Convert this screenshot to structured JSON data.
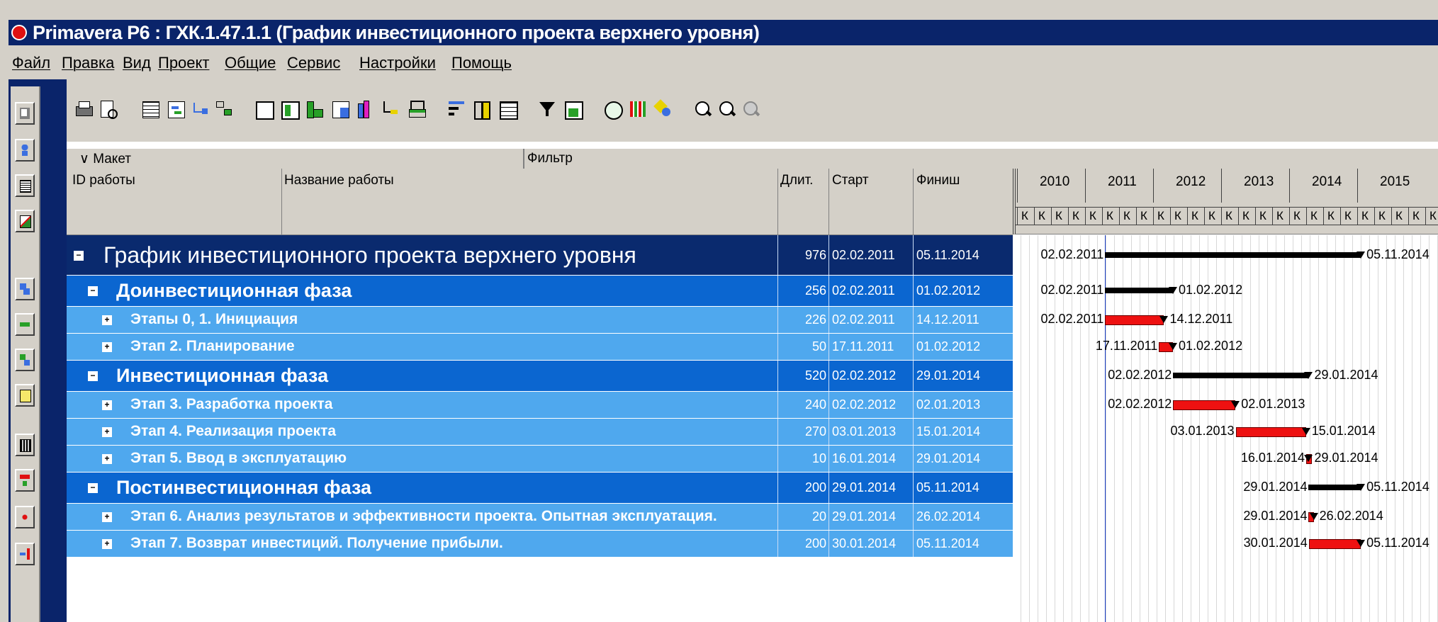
{
  "window": {
    "title": "Primavera P6 : ГХК.1.47.1.1 (График инвестиционного проекта верхнего уровня)"
  },
  "menu": [
    "Файл",
    "Правка",
    "Вид",
    "Проект",
    "Общие",
    "Сервис",
    "Настройки",
    "Помощь"
  ],
  "layout_bar": {
    "layout_label": "Макет",
    "filter_label": "Фильтр"
  },
  "columns": {
    "id": "ID работы",
    "name": "Название работы",
    "duration": "Длит.",
    "start": "Старт",
    "finish": "Финиш"
  },
  "timescale": {
    "years": [
      "2010",
      "2011",
      "2012",
      "2013",
      "2014",
      "2015"
    ],
    "quarter_label": "К"
  },
  "rows": [
    {
      "name": "График инвестиционного проекта верхнего уровня",
      "duration": "976",
      "start": "02.02.2011",
      "finish": "05.11.2014",
      "level": 0,
      "expander": "−"
    },
    {
      "name": "Доинвестиционная фаза",
      "duration": "256",
      "start": "02.02.2011",
      "finish": "01.02.2012",
      "level": 1,
      "expander": "−"
    },
    {
      "name": "Этапы 0, 1. Инициация",
      "duration": "226",
      "start": "02.02.2011",
      "finish": "14.12.2011",
      "level": 2,
      "expander": "+"
    },
    {
      "name": "Этап 2. Планирование",
      "duration": "50",
      "start": "17.11.2011",
      "finish": "01.02.2012",
      "level": 2,
      "expander": "+"
    },
    {
      "name": "Инвестиционная фаза",
      "duration": "520",
      "start": "02.02.2012",
      "finish": "29.01.2014",
      "level": 1,
      "expander": "−"
    },
    {
      "name": "Этап 3. Разработка проекта",
      "duration": "240",
      "start": "02.02.2012",
      "finish": "02.01.2013",
      "level": 2,
      "expander": "+"
    },
    {
      "name": "Этап 4. Реализация проекта",
      "duration": "270",
      "start": "03.01.2013",
      "finish": "15.01.2014",
      "level": 2,
      "expander": "+"
    },
    {
      "name": "Этап 5. Ввод в эксплуатацию",
      "duration": "10",
      "start": "16.01.2014",
      "finish": "29.01.2014",
      "level": 2,
      "expander": "+"
    },
    {
      "name": "Постинвестиционная фаза",
      "duration": "200",
      "start": "29.01.2014",
      "finish": "05.11.2014",
      "level": 1,
      "expander": "−"
    },
    {
      "name": "Этап 6. Анализ результатов  и эффективности проекта. Опытная эксплуатация.",
      "duration": "20",
      "start": "29.01.2014",
      "finish": "26.02.2014",
      "level": 2,
      "expander": "+"
    },
    {
      "name": "Этап 7. Возврат инвестиций. Получение прибыли.",
      "duration": "200",
      "start": "30.01.2014",
      "finish": "05.11.2014",
      "level": 2,
      "expander": "+"
    }
  ],
  "icons": {
    "left_toolbar": [
      "projects-icon",
      "resources-icon",
      "reports-icon",
      "tracking-icon",
      "wbs-icon",
      "activities-icon",
      "assignments-icon",
      "work-products-icon",
      "expenses-icon",
      "thresholds-icon",
      "issues-icon",
      "next-icon"
    ],
    "top_toolbar": [
      "print-icon",
      "print-preview-icon",
      "activity-table-icon",
      "gantt-chart-icon",
      "relationship-icon",
      "network-icon",
      "columns-icon",
      "bars-icon",
      "timescale-icon",
      "layout-icon",
      "resource-histogram-icon",
      "relationship-lines-icon",
      "progress-line-icon",
      "group-sort-icon",
      "details-icon",
      "table-icon",
      "filter-icon",
      "layout-options-icon",
      "schedule-icon",
      "level-icon",
      "store-baseline-icon",
      "zoom-in-icon",
      "zoom-out-icon",
      "zoom-fit-icon"
    ]
  },
  "colors": {
    "title_bar": "#0a246a",
    "level0": "#0a2a6e",
    "level1": "#0b66d0",
    "level2": "#4fa8ee",
    "bar_red": "#ee1111",
    "today_line": "#1a3fc6"
  }
}
